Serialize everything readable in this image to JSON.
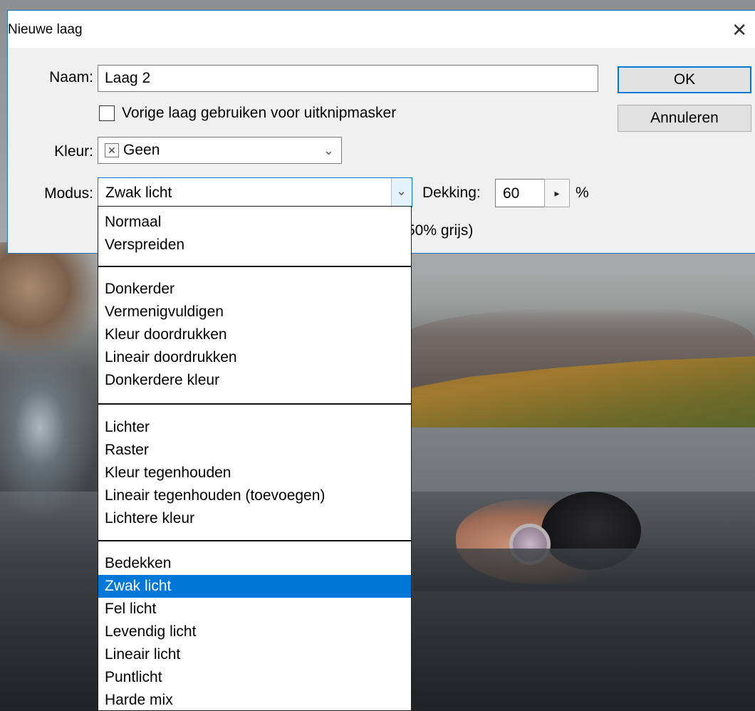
{
  "dialog": {
    "title": "Nieuwe laag",
    "close_glyph": "✕",
    "name_label": "Naam:",
    "name_value": "Laag 2",
    "clip_mask_label": "Vorige laag gebruiken voor uitknipmasker",
    "clip_mask_checked": false,
    "color_label": "Kleur:",
    "color_value": "Geen",
    "color_swatch_glyph": "✕",
    "mode_label": "Modus:",
    "mode_value": "Zwak licht",
    "opacity_label": "Dekking:",
    "opacity_value": "60",
    "opacity_unit": "%",
    "neutral_fill_fragment": "50% grijs)",
    "ok_label": "OK",
    "cancel_label": "Annuleren"
  },
  "mode_menu": {
    "selected": "Zwak licht",
    "groups": [
      [
        "Normaal",
        "Verspreiden"
      ],
      [
        "Donkerder",
        "Vermenigvuldigen",
        "Kleur doordrukken",
        "Lineair doordrukken",
        "Donkerdere kleur"
      ],
      [
        "Lichter",
        "Raster",
        "Kleur tegenhouden",
        "Lineair tegenhouden (toevoegen)",
        "Lichtere kleur"
      ],
      [
        "Bedekken",
        "Zwak licht",
        "Fel licht",
        "Levendig licht",
        "Lineair licht",
        "Puntlicht",
        "Harde mix"
      ]
    ]
  },
  "colors": {
    "accent": "#0078d7",
    "dialog_bg": "#f0f0f0",
    "dialog_border": "#1c76c2"
  }
}
